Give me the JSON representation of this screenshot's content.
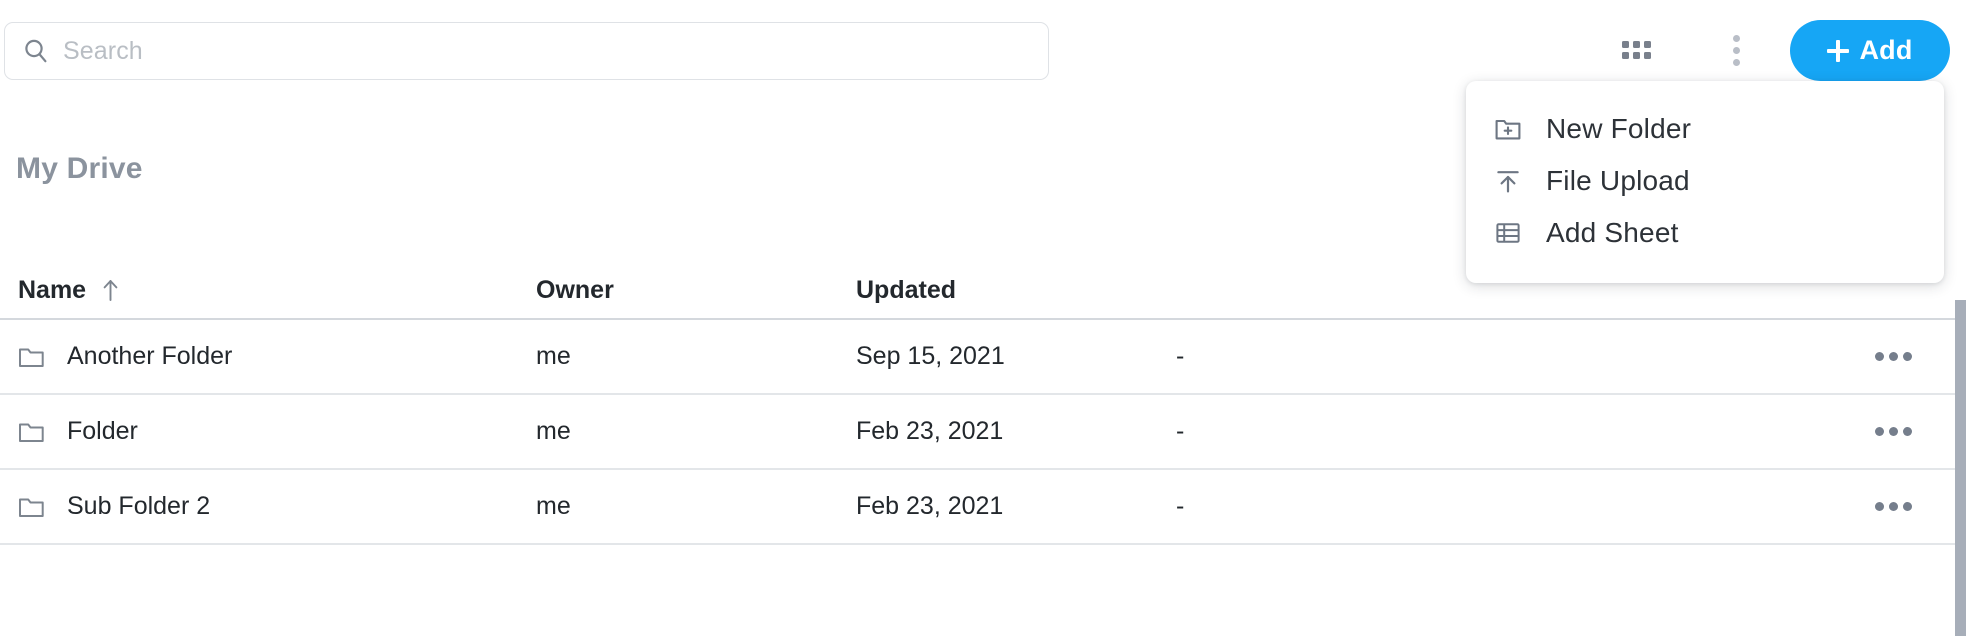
{
  "search": {
    "placeholder": "Search",
    "value": "",
    "icon": "search-icon"
  },
  "toolbar": {
    "grid_view_icon": "grid-icon",
    "more_options_icon": "kebab-menu-icon",
    "add_label": "Add",
    "add_plus_icon": "plus-icon",
    "accent_color": "#16a6f5"
  },
  "page": {
    "title": "My Drive",
    "title_color": "#8b939e"
  },
  "menu": {
    "items": [
      {
        "label": "New Folder",
        "icon": "folder-plus-icon"
      },
      {
        "label": "File Upload",
        "icon": "upload-icon"
      },
      {
        "label": "Add Sheet",
        "icon": "sheet-icon"
      }
    ]
  },
  "table": {
    "columns": [
      {
        "key": "name",
        "label": "Name",
        "sorted": true,
        "sort_icon": "arrow-up-icon"
      },
      {
        "key": "owner",
        "label": "Owner",
        "sorted": false,
        "sort_icon": ""
      },
      {
        "key": "updated",
        "label": "Updated",
        "sorted": false,
        "sort_icon": ""
      },
      {
        "key": "size",
        "label": "",
        "sorted": false,
        "sort_icon": ""
      }
    ],
    "row_action_icon": "ellipsis-icon",
    "rows": [
      {
        "icon": "folder-icon",
        "name": "Another Folder",
        "owner": "me",
        "updated": "Sep 15, 2021",
        "size": "-"
      },
      {
        "icon": "folder-icon",
        "name": "Folder",
        "owner": "me",
        "updated": "Feb 23, 2021",
        "size": "-"
      },
      {
        "icon": "folder-icon",
        "name": "Sub Folder 2",
        "owner": "me",
        "updated": "Feb 23, 2021",
        "size": "-"
      }
    ]
  },
  "scrollbar": {
    "orientation": "vertical"
  }
}
